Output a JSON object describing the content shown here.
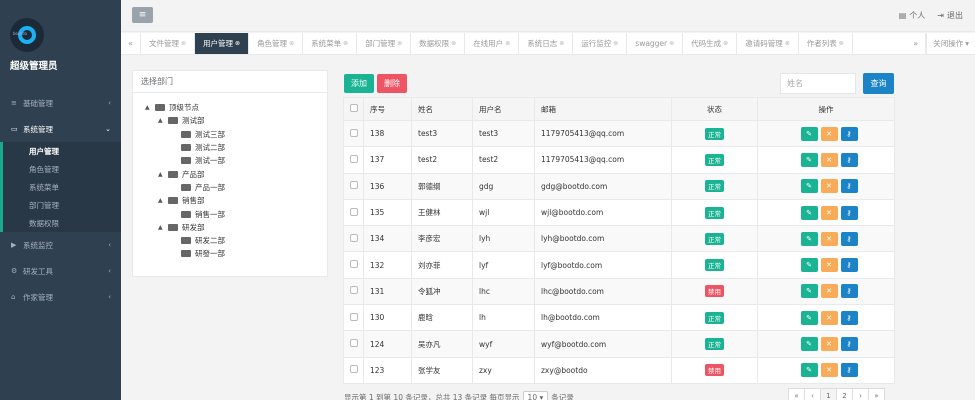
{
  "sidebar": {
    "title": "超级管理员",
    "logo_text": "bootdo",
    "menu": [
      {
        "icon": "≡",
        "label": "基础管理",
        "arrow": "‹"
      },
      {
        "icon": "▭",
        "label": "系统管理",
        "arrow": "⌄"
      }
    ],
    "sub_items": [
      "用户管理",
      "角色管理",
      "系统菜单",
      "部门管理",
      "数据权限"
    ],
    "menu_after": [
      {
        "icon": "▶",
        "label": "系统监控",
        "arrow": "‹"
      },
      {
        "icon": "⚙",
        "label": "研发工具",
        "arrow": "‹"
      },
      {
        "icon": "⌂",
        "label": "作家管理",
        "arrow": "‹"
      }
    ]
  },
  "header": {
    "menu_toggle": "≡",
    "personal": "个人",
    "logout": "退出"
  },
  "tabs": {
    "prev": "◀◀",
    "next": "▶▶",
    "items": [
      "文件管理",
      "用户管理",
      "角色管理",
      "系统菜单",
      "部门管理",
      "数据权限",
      "在线用户",
      "系统日志",
      "运行监控",
      "swagger",
      "代码生成",
      "邀请码管理",
      "作者列表"
    ],
    "active_index": 1,
    "close_ops": "关闭操作"
  },
  "tree": {
    "heading": "选择部门",
    "root": "顶级节点",
    "groups": [
      {
        "name": "测试部",
        "children": [
          "测试三部",
          "测试二部",
          "测试一部"
        ]
      },
      {
        "name": "产品部",
        "children": [
          "产品一部"
        ]
      },
      {
        "name": "销售部",
        "children": [
          "销售一部"
        ]
      },
      {
        "name": "研发部",
        "children": [
          "研发二部",
          "研發一部"
        ]
      }
    ]
  },
  "toolbar": {
    "add_label": "添加",
    "delete_label": "删除",
    "search_placeholder": "姓名",
    "query_label": "查询"
  },
  "table": {
    "headers": [
      "",
      "序号",
      "姓名",
      "用户名",
      "邮箱",
      "状态",
      "操作"
    ],
    "rows": [
      {
        "id": "138",
        "name": "test3",
        "username": "test3",
        "email": "1179705413@qq.com",
        "status": "正常",
        "ok": true
      },
      {
        "id": "137",
        "name": "test2",
        "username": "test2",
        "email": "1179705413@qq.com",
        "status": "正常",
        "ok": true
      },
      {
        "id": "136",
        "name": "郭德纲",
        "username": "gdg",
        "email": "gdg@bootdo.com",
        "status": "正常",
        "ok": true
      },
      {
        "id": "135",
        "name": "王健林",
        "username": "wjl",
        "email": "wjl@bootdo.com",
        "status": "正常",
        "ok": true
      },
      {
        "id": "134",
        "name": "李彦宏",
        "username": "lyh",
        "email": "lyh@bootdo.com",
        "status": "正常",
        "ok": true
      },
      {
        "id": "132",
        "name": "刘亦菲",
        "username": "lyf",
        "email": "lyf@bootdo.com",
        "status": "正常",
        "ok": true
      },
      {
        "id": "131",
        "name": "令狐冲",
        "username": "lhc",
        "email": "lhc@bootdo.com",
        "status": "禁用",
        "ok": false
      },
      {
        "id": "130",
        "name": "鹿晗",
        "username": "lh",
        "email": "lh@bootdo.com",
        "status": "正常",
        "ok": true
      },
      {
        "id": "124",
        "name": "吴亦凡",
        "username": "wyf",
        "email": "wyf@bootdo.com",
        "status": "正常",
        "ok": true
      },
      {
        "id": "123",
        "name": "张学友",
        "username": "zxy",
        "email": "zxy@bootdo",
        "status": "禁用",
        "ok": false
      }
    ]
  },
  "pagination": {
    "info_prefix": "显示第 1 到第 10 条记录，总共 13 条记录 每页显示",
    "page_size": "10",
    "info_suffix": "条记录",
    "pages": [
      "«",
      "‹",
      "1",
      "2",
      "›",
      "»"
    ],
    "current": "1"
  },
  "colors": {
    "sidebar_bg": "#2f4050",
    "primary": "#1ab394",
    "danger": "#ed5565",
    "warning": "#f8ac59",
    "info": "#1c84c6"
  }
}
